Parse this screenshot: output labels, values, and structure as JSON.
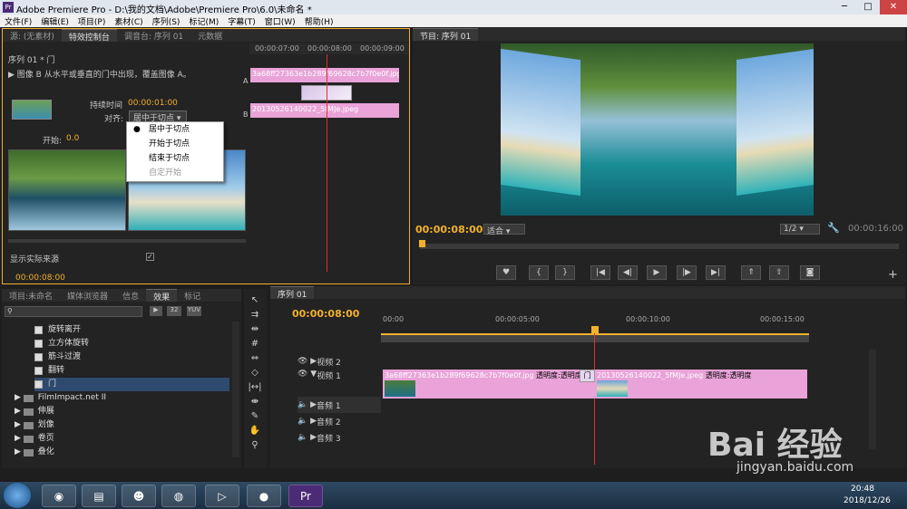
{
  "titlebar": {
    "app_icon": "Pr",
    "title": "Adobe Premiere Pro - D:\\我的文档\\Adobe\\Premiere Pro\\6.0\\未命名 *",
    "min": "─",
    "max": "□",
    "close": "✕"
  },
  "menu": [
    "文件(F)",
    "编辑(E)",
    "项目(P)",
    "素材(C)",
    "序列(S)",
    "标记(M)",
    "字幕(T)",
    "窗口(W)",
    "帮助(H)"
  ],
  "topleft_tabs": [
    "源: (无素材)",
    "特效控制台",
    "调音台: 序列 01",
    "元数据"
  ],
  "effect_controls": {
    "sequence": "序列 01 * 门",
    "description": "图像 B 从水平或垂直的门中出现，覆盖图像 A。",
    "duration_label": "持续时间",
    "duration_value": "00:00:01:00",
    "align_label": "对齐:",
    "align_value": "居中于切点",
    "start_label": "开始:",
    "start_value": "0.0",
    "show_actual": "显示实际来源",
    "timecode": "00:00:08:00",
    "mini_times": [
      "00:00:07:00",
      "00:00:08:00",
      "00:00:09:00"
    ],
    "clip_a": "3a68ff27363e1b289f69628c7b7f0e0f.jpg",
    "clip_b": "20130526140022_5fMJe.jpeg",
    "track_a": "A",
    "track_b": "B"
  },
  "align_menu": [
    {
      "label": "居中于切点",
      "checked": true
    },
    {
      "label": "开始于切点",
      "checked": false
    },
    {
      "label": "结束于切点",
      "checked": false
    },
    {
      "label": "自定开始",
      "checked": false,
      "disabled": true
    }
  ],
  "program": {
    "tab": "节目: 序列 01",
    "timecode": "00:00:08:00",
    "fit": "适合",
    "quality": "1/2",
    "duration": "00:00:16:00"
  },
  "project_tabs": [
    "项目:未命名",
    "媒体浏览器",
    "信息",
    "效果",
    "标记"
  ],
  "effects_tree": {
    "items": [
      "旋转离开",
      "立方体旋转",
      "筋斗过渡",
      "翻转",
      "门"
    ],
    "folders": [
      "FilmImpact.net II",
      "伸展",
      "划像",
      "卷页",
      "叠化"
    ]
  },
  "timeline": {
    "tab": "序列 01",
    "timecode": "00:00:08:00",
    "ruler": [
      "00:00",
      "00:00:05:00",
      "00:00:10:00",
      "00:00:15:00"
    ],
    "tracks": [
      "视频 2",
      "视频 1",
      "音频 1",
      "音频 2",
      "音频 3"
    ],
    "clip1": "3a68ff27363e1b289f69628c7b7f0e0f.jpg",
    "clip1_fx": "透明度:透明度",
    "transition": "门",
    "clip2": "20130526140022_5fMJe.jpeg",
    "clip2_fx": "透明度:透明度"
  },
  "taskbar": {
    "time": "20:48",
    "date": "2018/12/26"
  },
  "watermark": {
    "brand": "Bai 经验",
    "url": "jingyan.baidu.com"
  }
}
